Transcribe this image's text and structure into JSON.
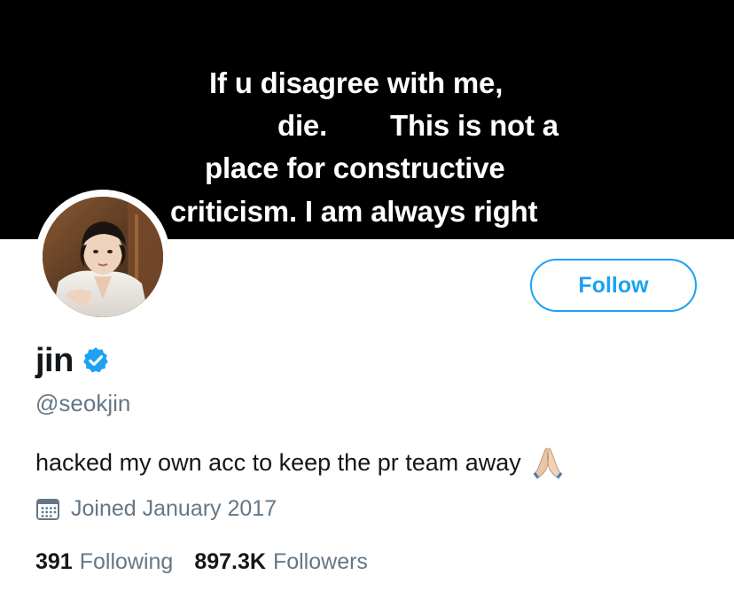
{
  "banner": {
    "lines": [
      "If u disagree with me,",
      "die.",
      "This is not a",
      "place for constructive",
      "criticism. I am always right"
    ]
  },
  "profile": {
    "display_name": "jin",
    "verified_icon": "verified-badge-icon",
    "handle": "@seokjin",
    "bio": "hacked my own acc to keep the pr team away",
    "bio_emoji": "🙏🏼",
    "joined": "Joined January 2017",
    "following_count": "391",
    "following_label": "Following",
    "followers_count": "897.3K",
    "followers_label": "Followers"
  },
  "actions": {
    "follow_label": "Follow"
  },
  "colors": {
    "accent": "#1da1f2",
    "secondary_text": "#657786",
    "primary_text": "#14171a",
    "banner_bg": "#000000"
  }
}
